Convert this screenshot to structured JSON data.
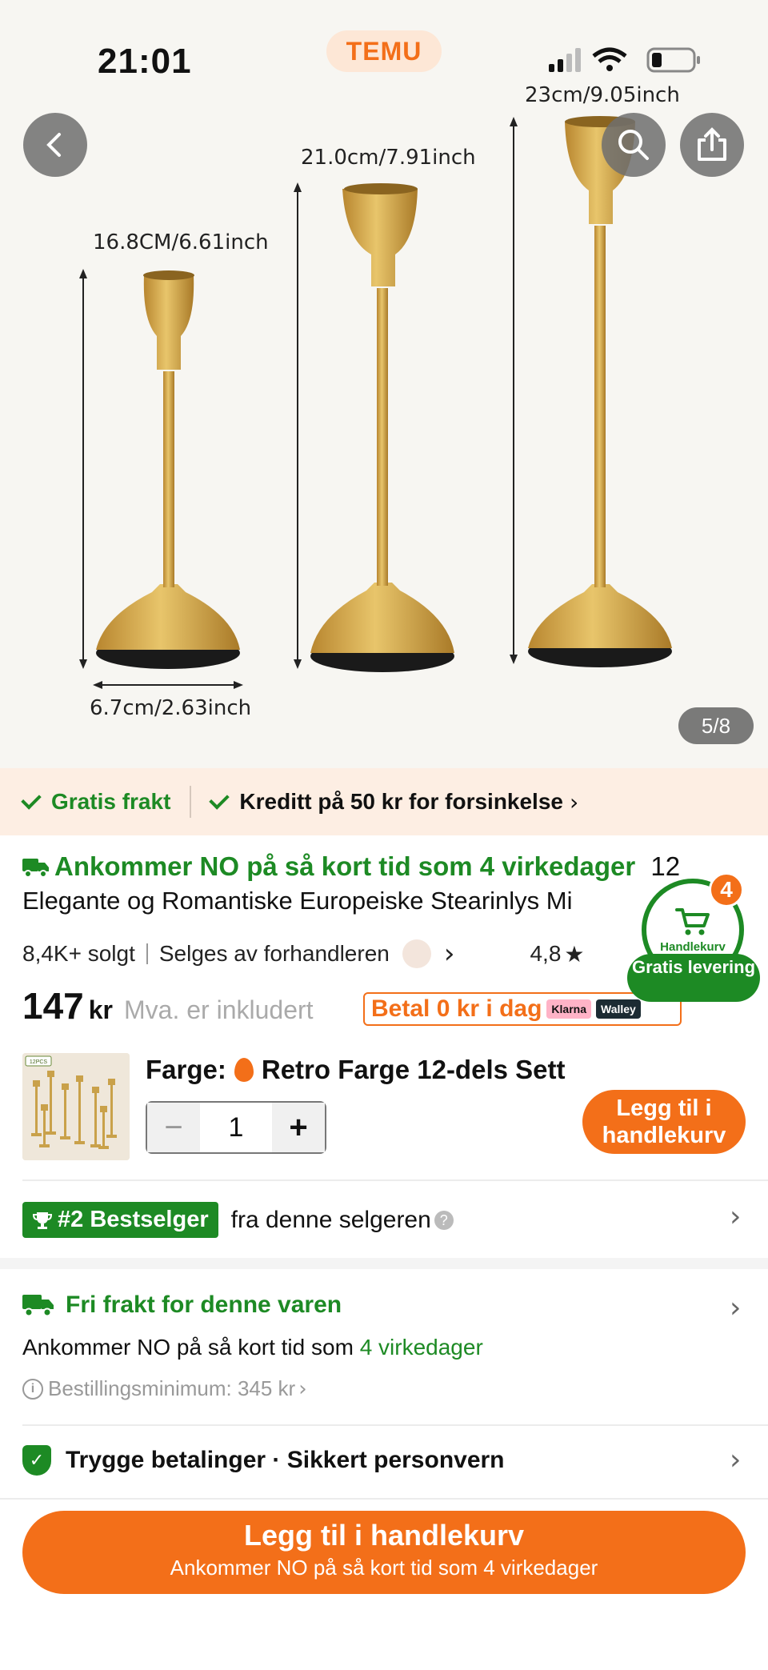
{
  "status_bar": {
    "time": "21:01",
    "brand": "TEMU"
  },
  "gallery": {
    "page_indicator": "5/8",
    "dimensions": {
      "small_height": "16.8CM/6.61inch",
      "medium_height": "21.0cm/7.91inch",
      "tall_height": "23cm/9.05inch",
      "base_width": "6.7cm/2.63inch"
    },
    "icons": [
      "back-icon",
      "search-icon",
      "share-icon"
    ]
  },
  "benefits": {
    "free_shipping": "Gratis frakt",
    "credit": "Kreditt på 50 kr for forsinkelse"
  },
  "product": {
    "arrival": "Ankommer NO på så kort tid som 4 virkedager",
    "title_tail": "12",
    "title": "Elegante og Romantiske Europeiske Stearinlys Mi",
    "sold": "8,4K+ solgt",
    "seller": "Selges av forhandleren",
    "rating": "4,8",
    "price": "147",
    "currency": "kr",
    "vat_note": "Mva. er inkludert",
    "pay_today": "Betal 0 kr i dag",
    "klarna": "Klarna",
    "walley": "Walley"
  },
  "cart": {
    "count": "4",
    "label": "Handlekurv",
    "free_delivery": "Gratis levering"
  },
  "variant": {
    "color_label": "Farge:",
    "color_value": "Retro Farge 12-dels Sett",
    "quantity": "1",
    "minus": "−",
    "plus": "+",
    "add_to_cart": "Legg til i handlekurv",
    "thumb_tag": "12PCS"
  },
  "bestseller": {
    "badge": "#2 Bestselger",
    "text": "fra denne selgeren"
  },
  "shipping": {
    "title": "Fri frakt for denne varen",
    "arrival_prefix": "Ankommer NO på så kort tid som",
    "arrival_days": "4 virkedager",
    "min_order": "Bestillingsminimum: 345 kr"
  },
  "security": {
    "text": "Trygge betalinger · Sikkert personvern"
  },
  "bottom_button": {
    "label": "Legg til i handlekurv",
    "sub": "Ankommer NO på så kort tid som 4 virkedager"
  },
  "colors": {
    "accent_orange": "#f36f19",
    "green": "#1d8a24",
    "banner_bg": "#fdeee3"
  }
}
